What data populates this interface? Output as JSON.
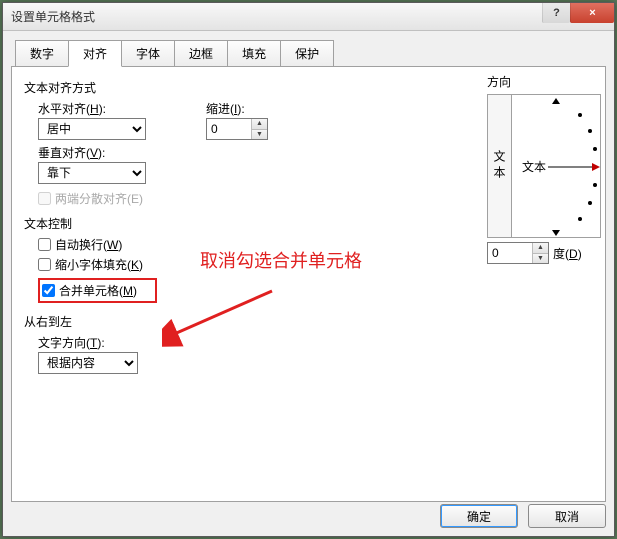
{
  "window": {
    "title": "设置单元格格式",
    "help": "?",
    "close": "×"
  },
  "tabs": {
    "items": [
      {
        "label": "数字"
      },
      {
        "label": "对齐"
      },
      {
        "label": "字体"
      },
      {
        "label": "边框"
      },
      {
        "label": "填充"
      },
      {
        "label": "保护"
      }
    ],
    "active_index": 1
  },
  "align": {
    "section": "文本对齐方式",
    "h_label": "水平对齐",
    "h_mnemonic": "H",
    "h_value": "居中",
    "indent_label": "缩进",
    "indent_mnemonic": "I",
    "indent_value": "0",
    "v_label": "垂直对齐",
    "v_mnemonic": "V",
    "v_value": "靠下",
    "justify_label": "两端分散对齐(E)"
  },
  "textctrl": {
    "section": "文本控制",
    "wrap": {
      "label": "自动换行",
      "mnemonic": "W",
      "checked": false
    },
    "shrink": {
      "label": "缩小字体填充",
      "mnemonic": "K",
      "checked": false
    },
    "merge": {
      "label": "合并单元格",
      "mnemonic": "M",
      "checked": true
    }
  },
  "rtl": {
    "section": "从右到左",
    "dir_label": "文字方向",
    "dir_mnemonic": "T",
    "dir_value": "根据内容"
  },
  "orientation": {
    "section": "方向",
    "vertical_text": "文本",
    "sample_text": "文本",
    "degrees_value": "0",
    "degrees_label": "度",
    "degrees_mnemonic": "D"
  },
  "annotation": {
    "text": "取消勾选合并单元格"
  },
  "footer": {
    "ok": "确定",
    "cancel": "取消"
  }
}
